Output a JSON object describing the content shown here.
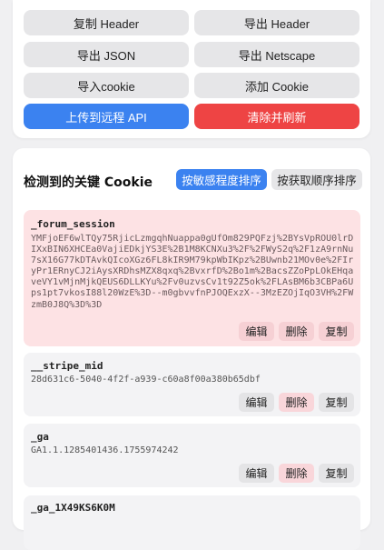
{
  "actions": {
    "copy_header": "复制 Header",
    "export_header": "导出 Header",
    "export_json": "导出 JSON",
    "export_netscape": "导出 Netscape",
    "import_cookie": "导入cookie",
    "add_cookie": "添加 Cookie",
    "upload_api": "上传到远程 API",
    "clear_refresh": "清除并刷新"
  },
  "key_cookies": {
    "title": "检测到的关键 Cookie",
    "sort_sensitivity": "按敏感程度排序",
    "sort_order": "按获取顺序排序",
    "items": [
      {
        "name": "_forum_session",
        "value": "YMFjoEF6wlTQy75RjicLzmgqhNuappa0gUfOm829PQFzj%2BYsVpROU0lrDIXxBIN6XHCEa0VajiEDkjYS3E%2B1M8KCNXu3%2F%2FWyS2q%2F1zA9rnNu7sX16G77kDTAvkQIcoXGz6FL8kIR9M79kpWbIKpz%2BUwnb21MOv0e%2FIryPr1ERnyCJ2iAysXRDhsMZX8qxq%2BvxrfD%2Bo1m%2BacsZZoPpLOkEHqaveVY1vMjnMjkQEUS6DLLKYu%2Fv0uzvsCv1t92Z5ok%2FLAsBM6b3CBPa6Ups1pt7vkosI88l20WzE%3D--m0gbvvfnPJOQExzX--3MzEZOjIqO3VH%2FWzmB0J8Q%3D%3D"
      },
      {
        "name": "__stripe_mid",
        "value": "28d631c6-5040-4f2f-a939-c60a8f00a380b65dbf"
      },
      {
        "name": "_ga",
        "value": "GA1.1.1285401436.1755974242"
      },
      {
        "name": "_ga_1X49KS6K0M",
        "value": ""
      }
    ],
    "edit": "编辑",
    "delete": "删除",
    "copy": "复制"
  }
}
